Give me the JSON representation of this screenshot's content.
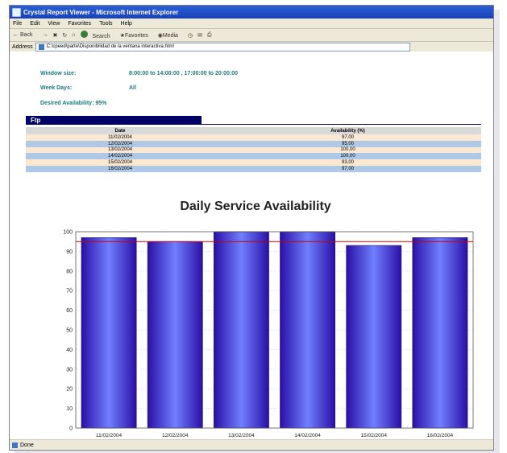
{
  "window": {
    "title": "Crystal Report Viewer - Microsoft Internet Explorer"
  },
  "menu": [
    "File",
    "Edit",
    "View",
    "Favorites",
    "Tools",
    "Help"
  ],
  "toolbar": {
    "back": "Back",
    "search": "Search",
    "favorites": "Favorites",
    "media": "Media"
  },
  "address": {
    "label": "Address",
    "value": "C:\\cpeed\\parte\\Disponibilidad de la ventana interactiva.html"
  },
  "report": {
    "window_size_label": "Window size:",
    "window_size_value": "8:00:00 to 14:00:00  ,  17:00:00 to 20:00:00",
    "week_days_label": "Week Days:",
    "week_days_value": "All",
    "desired_label": "Desired Availability: 95%",
    "section_title": "Ftp"
  },
  "table": {
    "headers": [
      "Date",
      "Availability (%)"
    ],
    "rows": [
      [
        "11/02/2004",
        "97,00"
      ],
      [
        "12/02/2004",
        "95,00"
      ],
      [
        "13/02/2004",
        "100,00"
      ],
      [
        "14/02/2004",
        "100,00"
      ],
      [
        "15/02/2004",
        "93,00"
      ],
      [
        "16/02/2004",
        "97,00"
      ]
    ]
  },
  "colors": {
    "bar_dark": "#2a0fa8",
    "bar_light": "#6f7fff",
    "target_line": "#cc0000",
    "section": "#000066"
  },
  "status": {
    "text": "Done"
  },
  "chart_data": {
    "type": "bar",
    "title": "Daily Service Availability",
    "categories": [
      "11/02/2004",
      "12/02/2004",
      "13/02/2004",
      "14/02/2004",
      "15/02/2004",
      "16/02/2004"
    ],
    "values": [
      97,
      95,
      100,
      100,
      93,
      97
    ],
    "target": 95,
    "ylim": [
      0,
      100
    ],
    "yticks": [
      0,
      10,
      20,
      30,
      40,
      50,
      60,
      70,
      80,
      90,
      100
    ],
    "grid": true
  }
}
